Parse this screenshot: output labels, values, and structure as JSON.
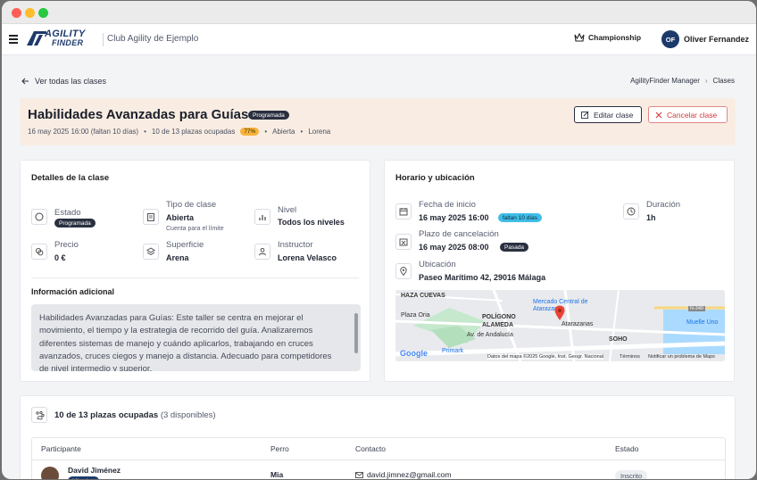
{
  "app": {
    "club_name": "Club Agility de Ejemplo",
    "logo": {
      "line1": "AGILITY",
      "line2": "FINDER"
    },
    "championship_label": "Championship",
    "user": {
      "initials": "OF",
      "name": "Oliver Fernandez"
    }
  },
  "nav": {
    "back_label": "Ver todas las clases",
    "breadcrumb": [
      "AgilityFinder Manager",
      "Clases"
    ]
  },
  "header": {
    "title": "Habilidades Avanzadas para Guías",
    "status_badge": "Programada",
    "date": "16 may 2025 16:00 (faltan 10 días)",
    "spots": "10 de 13 plazas ocupadas",
    "percent": "77%",
    "visibility": "Abierta",
    "venue_short": "Lorena",
    "edit_label": "Editar clase",
    "cancel_label": "Cancelar clase"
  },
  "details": {
    "title": "Detalles de la clase",
    "estado_label": "Estado",
    "estado_value": "Programada",
    "tipo_label": "Tipo de clase",
    "tipo_value": "Abierta",
    "tipo_sub": "Cuenta para el límite",
    "nivel_label": "Nivel",
    "nivel_value": "Todos los niveles",
    "precio_label": "Precio",
    "precio_value": "0 €",
    "superficie_label": "Superficie",
    "superficie_value": "Arena",
    "instructor_label": "Instructor",
    "instructor_value": "Lorena Velasco",
    "info_title": "Información adicional",
    "info_text": "Habilidades Avanzadas para Guías: Este taller se centra en mejorar el movimiento, el tiempo y la estrategia de recorrido del guía. Analizaremos diferentes sistemas de manejo y cuándo aplicarlos, trabajando en cruces avanzados, cruces ciegos y manejo a distancia. Adecuado para competidores de nivel intermedio y superior."
  },
  "schedule": {
    "title": "Horario y ubicación",
    "inicio_label": "Fecha de inicio",
    "inicio_value": "16 may 2025 16:00",
    "inicio_badge": "faltan 10 días",
    "duracion_label": "Duración",
    "duracion_value": "1h",
    "plazo_label": "Plazo de cancelación",
    "plazo_value": "16 may 2025 08:00",
    "plazo_badge": "Pasada",
    "ubicacion_label": "Ubicación",
    "ubicacion_value": "Paseo Marítimo 42, 29016 Málaga",
    "map": {
      "labels": [
        "HAZA CUEVAS",
        "POLÍGONO",
        "ALAMEDA",
        "Mercado Central de",
        "Atarazanas",
        "Atarazanas",
        "Av. de Andalucía",
        "SOHO",
        "Muelle Uno",
        "Primark",
        "Plaza Oria",
        "N-340"
      ],
      "attribution": "Datos del mapa ©2025 Google, Inst. Geogr. Nacional",
      "terms": "Términos",
      "report": "Notificar un problema de Maps",
      "google": "Google"
    }
  },
  "participants": {
    "summary_bold": "10 de 13 plazas ocupadas",
    "summary_rest": "(3 disponibles)",
    "columns": [
      "Participante",
      "Perro",
      "Contacto",
      "Estado"
    ],
    "rows": [
      {
        "name": "David Jiménez",
        "role": "Miembro",
        "dog": "Mia",
        "email": "david.jimnez@gmail.com",
        "status": "Inscrito"
      }
    ]
  },
  "colors": {
    "accent": "#1b3a6b",
    "banner": "#f9ede3",
    "danger": "#d03b3b",
    "warning": "#f6b23b",
    "info": "#3fbde8"
  }
}
